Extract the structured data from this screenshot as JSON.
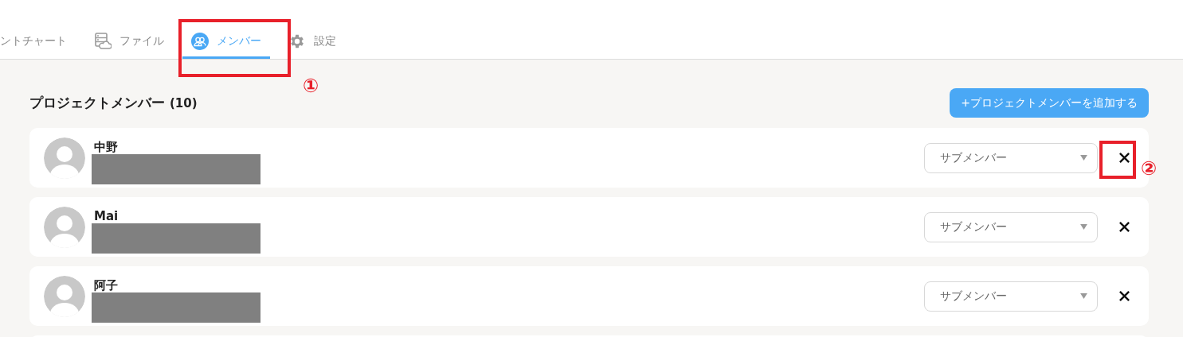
{
  "tabs": [
    {
      "label": "ントチャート",
      "selected": false
    },
    {
      "label": "ファイル",
      "selected": false
    },
    {
      "label": "メンバー",
      "selected": true
    },
    {
      "label": "設定",
      "selected": false
    }
  ],
  "callouts": [
    "①",
    "②"
  ],
  "heading": {
    "title": "プロジェクトメンバー",
    "count": "(10)"
  },
  "add_button": "+プロジェクトメンバーを追加する",
  "members": [
    {
      "name": "中野",
      "role": "サブメンバー"
    },
    {
      "name": "Mai",
      "role": "サブメンバー"
    },
    {
      "name": "阿子",
      "role": "サブメンバー"
    }
  ]
}
